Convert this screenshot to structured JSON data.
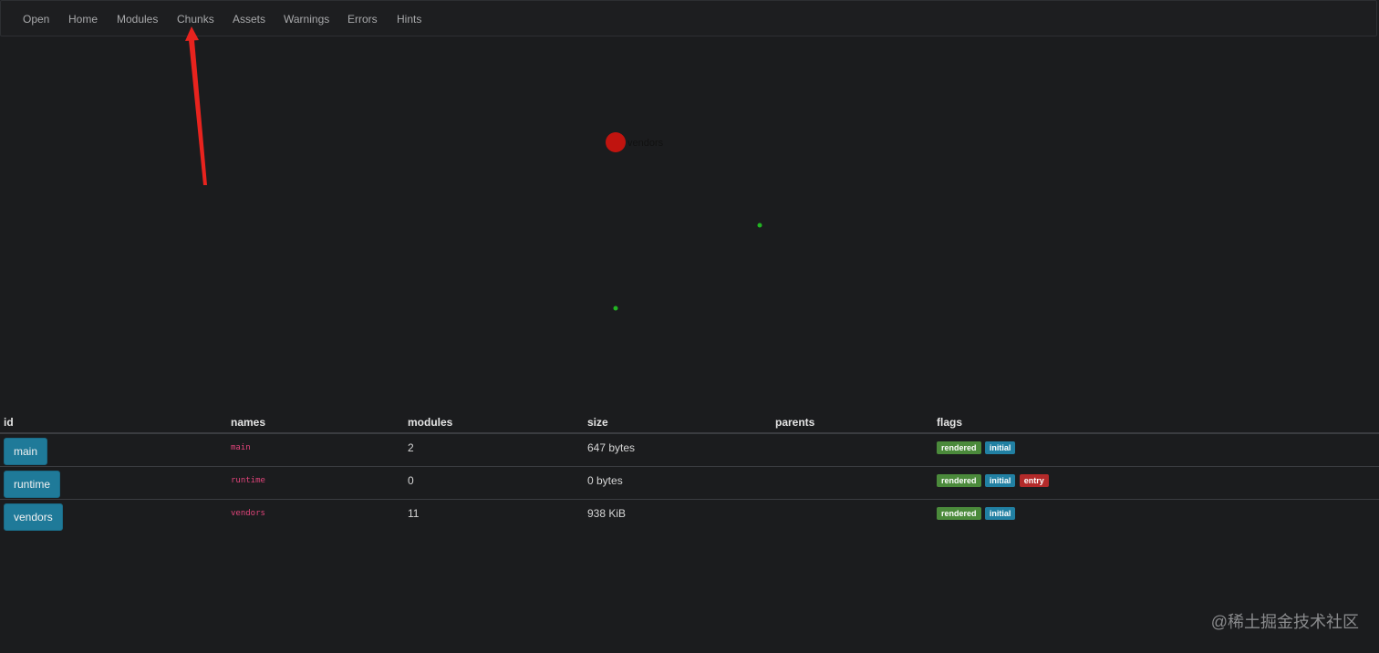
{
  "nav": {
    "items": [
      "Open",
      "Home",
      "Modules",
      "Chunks",
      "Assets",
      "Warnings",
      "Errors",
      "Hints"
    ]
  },
  "graph": {
    "node_label": "vendors",
    "node_color": "#c0140f",
    "dot_color": "#22b422",
    "arrow_color": "#e8231e"
  },
  "table": {
    "headers": {
      "id": "id",
      "names": "names",
      "modules": "modules",
      "size": "size",
      "parents": "parents",
      "flags": "flags"
    },
    "rows": [
      {
        "id": "main",
        "names": "main",
        "modules": "2",
        "size": "647 bytes",
        "parents": "",
        "flags": [
          "rendered",
          "initial"
        ]
      },
      {
        "id": "runtime",
        "names": "runtime",
        "modules": "0",
        "size": "0 bytes",
        "parents": "",
        "flags": [
          "rendered",
          "initial",
          "entry"
        ]
      },
      {
        "id": "vendors",
        "names": "vendors",
        "modules": "11",
        "size": "938 KiB",
        "parents": "",
        "flags": [
          "rendered",
          "initial"
        ]
      }
    ]
  },
  "colors": {
    "background": "#1b1c1e",
    "button": "#1f7a99",
    "name_code": "#e0447a",
    "badge_rendered": "#4b8a3b",
    "badge_initial": "#2180a3",
    "badge_entry": "#b32a2a"
  },
  "watermark": "@稀土掘金技术社区"
}
